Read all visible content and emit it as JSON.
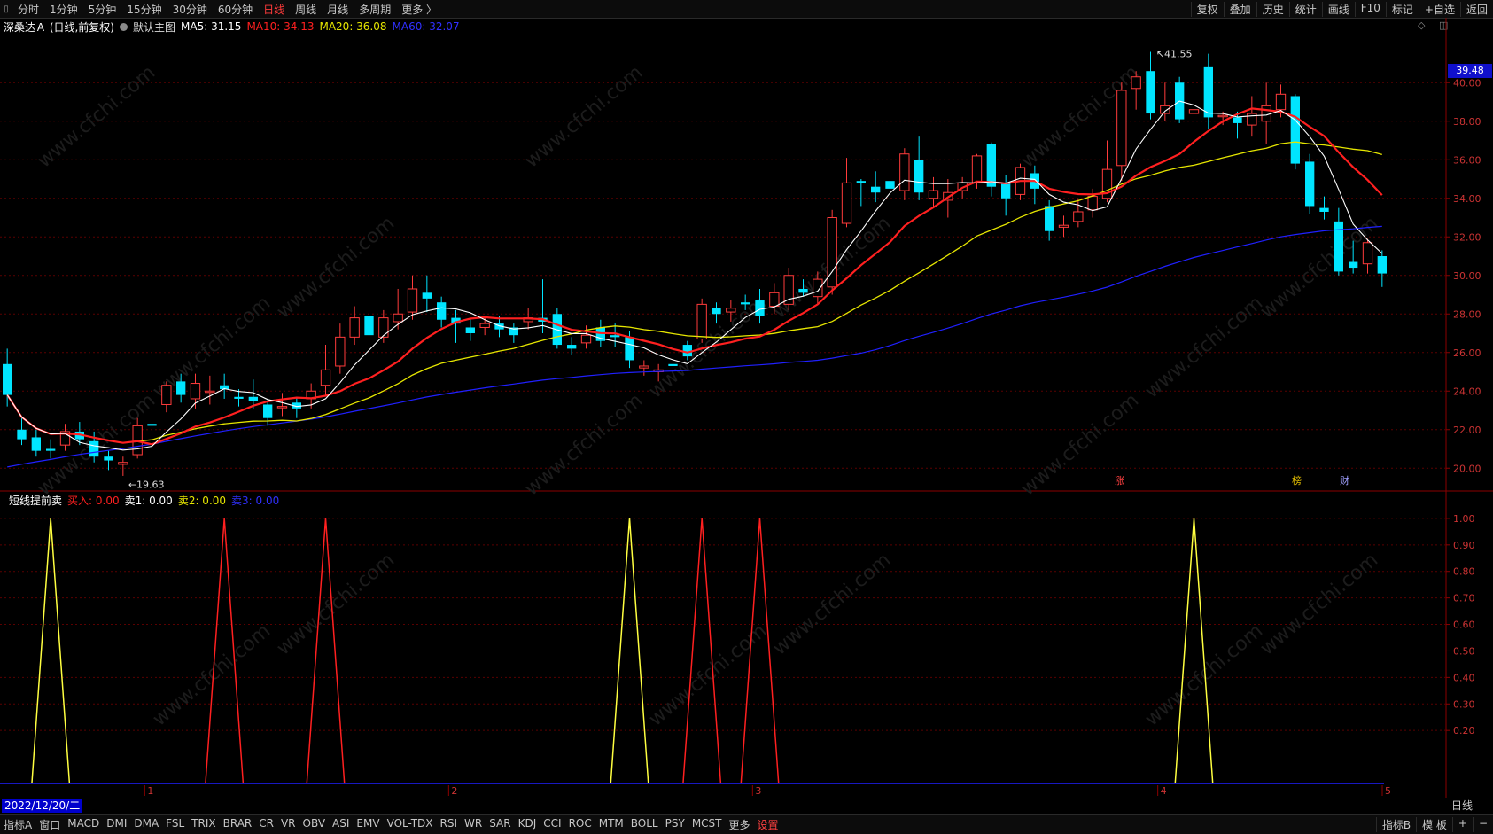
{
  "toolbar": {
    "window_icon": "▯",
    "periods": [
      "分时",
      "1分钟",
      "5分钟",
      "15分钟",
      "30分钟",
      "60分钟",
      "日线",
      "周线",
      "月线",
      "多周期",
      "更多 〉"
    ],
    "active_period": "日线",
    "right_buttons": [
      "复权",
      "叠加",
      "历史",
      "统计",
      "画线",
      "F10",
      "标记",
      "+自选",
      "返回"
    ]
  },
  "legend": {
    "stock": "深桑达Ａ (日线,前复权)",
    "main_chart": "默认主图",
    "ma5_label": "MA5: 31.15",
    "ma10_label": "MA10: 34.13",
    "ma20_label": "MA20: 36.08",
    "ma60_label": "MA60: 32.07",
    "top_icons": "◇ ◫"
  },
  "indicator_legend": {
    "name": "短线提前卖",
    "buy_label": "买入: 0.00",
    "sell1_label": "卖1: 0.00",
    "sell2_label": "卖2: 0.00",
    "sell3_label": "卖3: 0.00"
  },
  "price_tag": "39.48",
  "period_box": "日线",
  "date_box": "2022/12/20/二",
  "markers": {
    "zhang": "涨",
    "bang": "榜",
    "cai": "财"
  },
  "bottom_bar": {
    "left": [
      "指标A",
      "窗口",
      "MACD",
      "DMI",
      "DMA",
      "FSL",
      "TRIX",
      "BRAR",
      "CR",
      "VR",
      "OBV",
      "ASI",
      "EMV",
      "VOL-TDX",
      "RSI",
      "WR",
      "SAR",
      "KDJ",
      "CCI",
      "ROC",
      "MTM",
      "BOLL",
      "PSY",
      "MCST",
      "更多",
      "设置"
    ],
    "right": [
      "指标B",
      "模 板",
      "+",
      "−"
    ]
  },
  "colors": {
    "up": "#ff3b3b",
    "down": "#00e5ff",
    "ma5": "#ffffff",
    "ma10": "#ff2020",
    "ma20": "#e6e600",
    "ma60": "#2020ff",
    "sell": "#ffff40",
    "buy": "#ff2020"
  },
  "chart_data": {
    "type": "candlestick",
    "price_axis": {
      "ticks": [
        "40.00",
        "38.00",
        "36.00",
        "34.00",
        "32.00",
        "30.00",
        "28.00",
        "26.00",
        "24.00",
        "22.00",
        "20.00"
      ],
      "min": 19.0,
      "max": 43.0
    },
    "indicator_axis": {
      "ticks": [
        "1.00",
        "0.90",
        "0.80",
        "0.70",
        "0.60",
        "0.50",
        "0.40",
        "0.30",
        "0.20"
      ],
      "min": 0,
      "max": 1.1
    },
    "month_labels": [
      "1",
      "2",
      "3",
      "4",
      "5"
    ],
    "annotations": {
      "high": "41.55",
      "low": "19.63"
    },
    "candles": [
      [
        25.4,
        23.8,
        26.2,
        23.2
      ],
      [
        22.0,
        21.5,
        22.7,
        21.2
      ],
      [
        21.6,
        20.9,
        22.0,
        20.6
      ],
      [
        21.0,
        20.9,
        21.5,
        20.5
      ],
      [
        21.2,
        21.9,
        22.3,
        20.9
      ],
      [
        21.9,
        21.5,
        22.4,
        21.2
      ],
      [
        21.4,
        20.6,
        21.9,
        20.3
      ],
      [
        20.6,
        20.4,
        20.9,
        19.9
      ],
      [
        20.2,
        20.3,
        20.6,
        19.6
      ],
      [
        20.7,
        22.2,
        22.6,
        20.5
      ],
      [
        22.3,
        22.2,
        22.6,
        21.6
      ],
      [
        23.3,
        24.3,
        24.5,
        22.9
      ],
      [
        24.5,
        23.8,
        24.9,
        23.4
      ],
      [
        23.6,
        24.4,
        24.9,
        23.1
      ],
      [
        24.0,
        24.0,
        24.8,
        23.3
      ],
      [
        24.3,
        24.1,
        24.9,
        23.6
      ],
      [
        23.7,
        23.6,
        24.1,
        23.2
      ],
      [
        23.7,
        23.5,
        24.6,
        23.1
      ],
      [
        23.3,
        22.6,
        23.6,
        22.2
      ],
      [
        23.2,
        23.2,
        23.9,
        22.7
      ],
      [
        23.4,
        23.1,
        23.7,
        22.6
      ],
      [
        23.6,
        24.0,
        24.4,
        23.1
      ],
      [
        24.3,
        25.1,
        26.4,
        23.8
      ],
      [
        25.3,
        26.8,
        27.5,
        24.9
      ],
      [
        26.8,
        27.8,
        28.4,
        26.4
      ],
      [
        27.9,
        26.9,
        28.3,
        26.4
      ],
      [
        26.8,
        27.8,
        28.2,
        26.5
      ],
      [
        27.6,
        28.0,
        29.3,
        27.2
      ],
      [
        28.1,
        29.3,
        30.0,
        27.7
      ],
      [
        29.1,
        28.8,
        30.0,
        28.1
      ],
      [
        28.6,
        27.7,
        28.9,
        27.3
      ],
      [
        27.8,
        27.5,
        28.2,
        26.5
      ],
      [
        27.3,
        27.0,
        27.8,
        26.6
      ],
      [
        27.3,
        27.5,
        27.9,
        26.9
      ],
      [
        27.5,
        27.2,
        27.9,
        26.8
      ],
      [
        27.3,
        26.9,
        27.5,
        26.5
      ],
      [
        27.6,
        27.8,
        28.3,
        27.2
      ],
      [
        27.8,
        27.6,
        29.8,
        27.0
      ],
      [
        28.0,
        26.4,
        28.3,
        26.2
      ],
      [
        26.4,
        26.2,
        26.8,
        25.9
      ],
      [
        26.5,
        26.9,
        27.4,
        26.2
      ],
      [
        27.3,
        26.6,
        27.7,
        26.3
      ],
      [
        26.9,
        26.8,
        27.5,
        26.3
      ],
      [
        26.8,
        25.6,
        27.1,
        25.2
      ],
      [
        25.2,
        25.3,
        25.6,
        24.8
      ],
      [
        25.0,
        25.1,
        25.4,
        24.5
      ],
      [
        25.4,
        25.3,
        25.8,
        24.9
      ],
      [
        26.4,
        25.8,
        26.6,
        25.6
      ],
      [
        26.7,
        28.5,
        28.8,
        26.5
      ],
      [
        28.3,
        28.0,
        28.6,
        27.5
      ],
      [
        28.1,
        28.3,
        28.7,
        27.6
      ],
      [
        28.6,
        28.5,
        29.0,
        28.2
      ],
      [
        28.7,
        27.9,
        29.3,
        27.5
      ],
      [
        28.4,
        29.1,
        29.6,
        28.0
      ],
      [
        28.5,
        30.0,
        30.4,
        28.2
      ],
      [
        29.3,
        29.1,
        29.8,
        28.9
      ],
      [
        28.9,
        29.8,
        30.2,
        28.5
      ],
      [
        29.4,
        33.0,
        33.4,
        29.0
      ],
      [
        32.7,
        34.8,
        36.1,
        32.5
      ],
      [
        34.9,
        34.8,
        35.0,
        33.6
      ],
      [
        34.6,
        34.3,
        35.4,
        33.8
      ],
      [
        34.9,
        34.5,
        36.1,
        34.2
      ],
      [
        34.4,
        36.3,
        36.6,
        33.9
      ],
      [
        36.0,
        34.3,
        37.2,
        33.9
      ],
      [
        34.0,
        34.4,
        35.1,
        33.5
      ],
      [
        33.9,
        34.3,
        35.0,
        33.0
      ],
      [
        34.4,
        34.8,
        35.1,
        34.0
      ],
      [
        34.8,
        36.2,
        36.3,
        34.5
      ],
      [
        36.8,
        34.6,
        36.9,
        34.1
      ],
      [
        34.8,
        34.0,
        35.2,
        33.1
      ],
      [
        34.2,
        35.6,
        35.8,
        33.9
      ],
      [
        35.3,
        34.5,
        35.7,
        33.7
      ],
      [
        33.6,
        32.3,
        33.9,
        31.8
      ],
      [
        32.5,
        32.6,
        33.1,
        32.0
      ],
      [
        32.8,
        33.3,
        34.0,
        32.5
      ],
      [
        33.4,
        34.1,
        34.5,
        33.0
      ],
      [
        34.0,
        35.5,
        37.0,
        33.8
      ],
      [
        35.7,
        39.6,
        40.0,
        34.9
      ],
      [
        39.7,
        40.3,
        40.6,
        38.6
      ],
      [
        40.6,
        38.4,
        41.6,
        38.1
      ],
      [
        38.4,
        38.8,
        40.0,
        38.0
      ],
      [
        40.0,
        38.1,
        40.3,
        37.9
      ],
      [
        38.4,
        38.6,
        41.1,
        38.0
      ],
      [
        40.8,
        38.2,
        41.5,
        37.6
      ],
      [
        38.3,
        38.3,
        38.5,
        37.8
      ],
      [
        38.2,
        37.9,
        38.5,
        37.1
      ],
      [
        37.8,
        38.4,
        39.3,
        37.2
      ],
      [
        38.0,
        38.8,
        40.0,
        36.8
      ],
      [
        38.6,
        39.4,
        39.9,
        38.2
      ],
      [
        39.3,
        35.8,
        39.4,
        35.5
      ],
      [
        35.9,
        33.6,
        36.3,
        33.2
      ],
      [
        33.5,
        33.3,
        34.1,
        32.9
      ],
      [
        32.8,
        30.2,
        33.5,
        30.0
      ],
      [
        30.7,
        30.4,
        31.8,
        30.1
      ],
      [
        30.6,
        31.7,
        31.9,
        30.1
      ],
      [
        31.0,
        30.1,
        31.3,
        29.4
      ]
    ],
    "sell_days": [
      3,
      43,
      82
    ],
    "buy_days": [
      15,
      22,
      48,
      52
    ]
  }
}
